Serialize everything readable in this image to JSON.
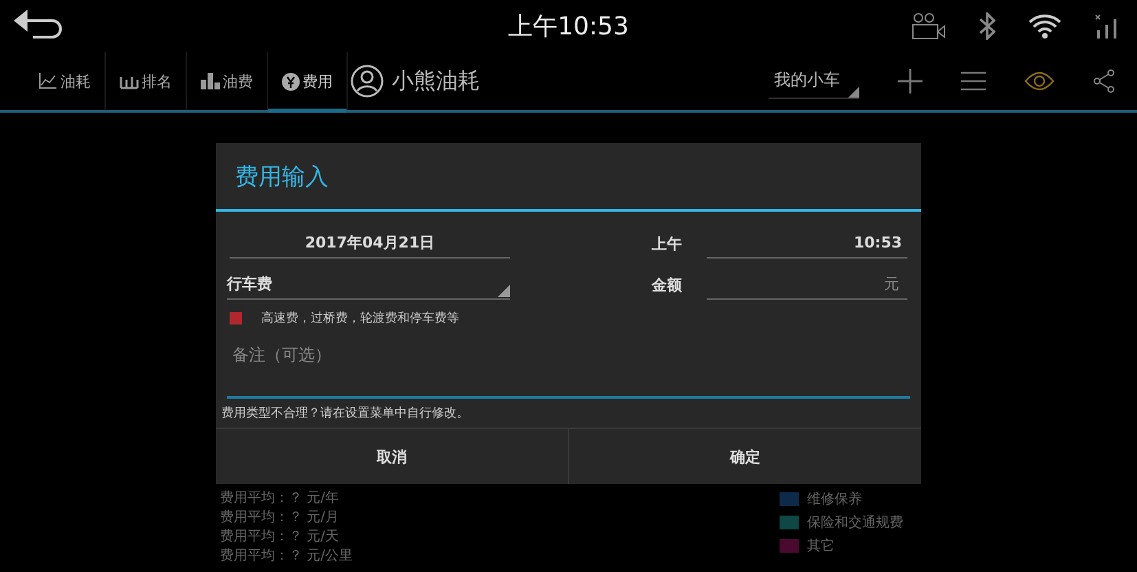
{
  "status_bar": {
    "time": "上午10:53"
  },
  "toolbar": {
    "tabs": [
      {
        "label": "油耗",
        "kind": "line",
        "selected": false
      },
      {
        "label": "排名",
        "kind": "rank",
        "selected": false
      },
      {
        "label": "油费",
        "kind": "bars",
        "selected": false
      },
      {
        "label": "费用",
        "kind": "yen",
        "selected": true
      }
    ],
    "app_title": "小熊油耗",
    "car_selector": "我的小车"
  },
  "background": {
    "stats": [
      "费用平均：？ 元/年",
      "费用平均：？ 元/月",
      "费用平均：？ 元/天",
      "费用平均：？ 元/公里"
    ],
    "legend": [
      {
        "label": "维修保养",
        "color": "#0d2a4a"
      },
      {
        "label": "保险和交通规费",
        "color": "#0f4646"
      },
      {
        "label": "其它",
        "color": "#4a0a30"
      }
    ]
  },
  "dialog": {
    "title": "费用输入",
    "date": "2017年04月21日",
    "ampm": "上午",
    "time": "10:53",
    "category": "行车费",
    "amount_label": "金额",
    "amount_unit": "元",
    "category_hint": {
      "text": "高速费，过桥费，轮渡费和停车费等",
      "color": "#b0282e"
    },
    "note": {
      "placeholder": "备注（可选）"
    },
    "footer_note": "费用类型不合理？请在设置菜单中自行修改。",
    "buttons": [
      "取消",
      "确定"
    ]
  }
}
